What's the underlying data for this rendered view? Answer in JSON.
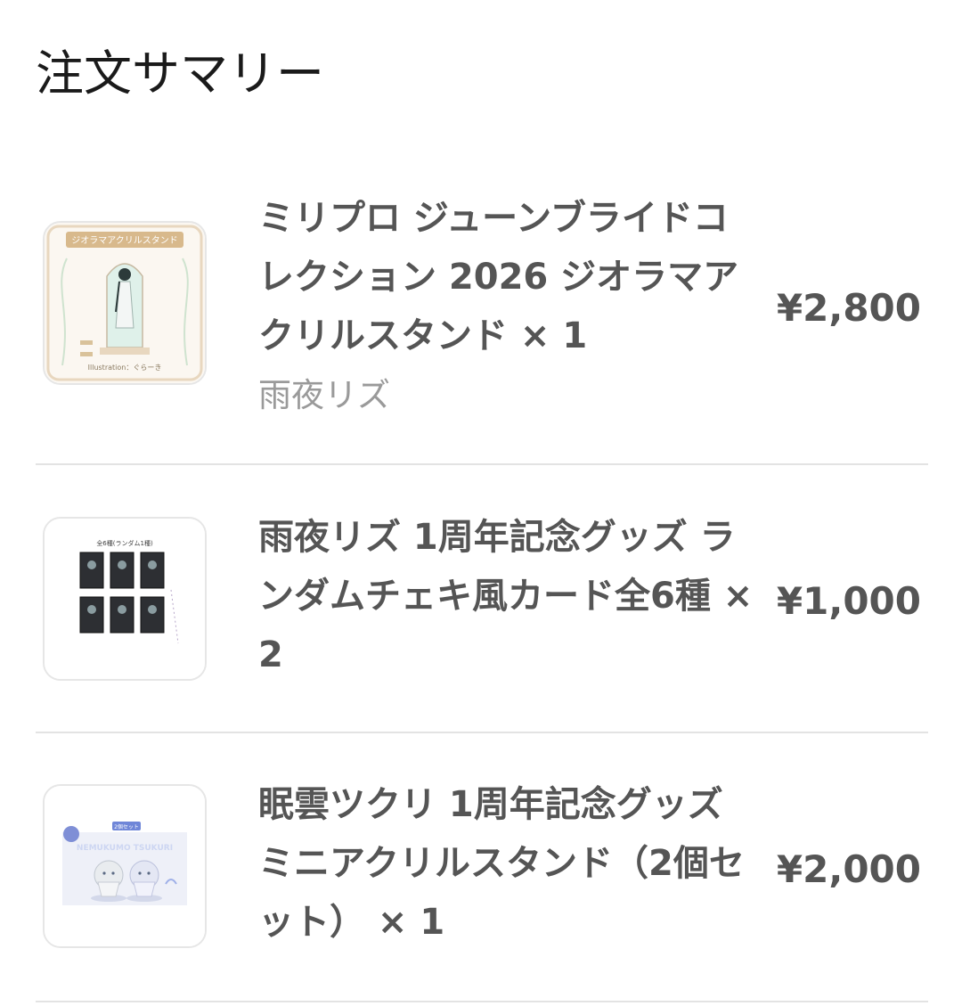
{
  "header": {
    "title": "注文サマリー"
  },
  "items": [
    {
      "name": "ミリプロ ジューンブライドコレクション 2026 ジオラマアクリルスタンド × 1",
      "talent": "雨夜リズ",
      "price": "¥2,800",
      "thumb": {
        "banner": "ジオラマアクリルスタンド",
        "caption": "Illustration：ぐらーき"
      }
    },
    {
      "name": "雨夜リズ 1周年記念グッズ ランダムチェキ風カード全6種 × 2",
      "price": "¥1,000",
      "thumb": {
        "caption": "全6種(ランダム1種)"
      }
    },
    {
      "name": "眠雲ツクリ 1周年記念グッズ ミニアクリルスタンド（2個セット） × 1",
      "price": "¥2,000",
      "thumb": {
        "badge": "2個セット",
        "logo": "NEMUKUMO TSUKURI"
      }
    }
  ],
  "colors": {
    "text": "#555555",
    "muted": "#9a9a9a",
    "title": "#1a1a1a",
    "divider": "#e3e3e3"
  }
}
